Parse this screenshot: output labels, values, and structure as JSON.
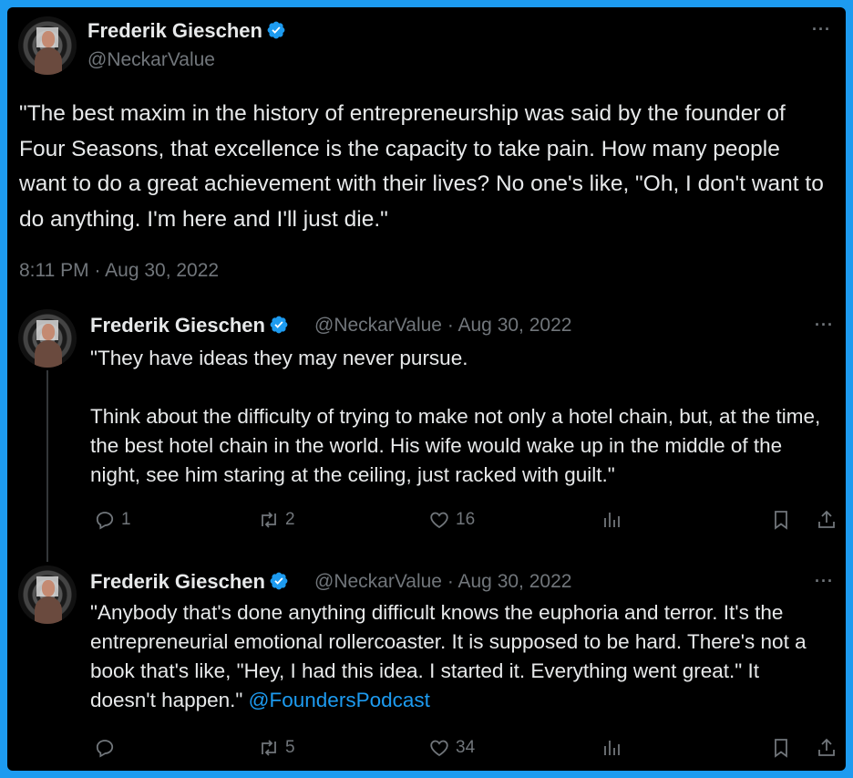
{
  "main_tweet": {
    "author_name": "Frederik Gieschen",
    "handle": "@NeckarValue",
    "text": "\"The best maxim in the history of entrepreneurship was said by the founder of Four Seasons, that excellence is the capacity to take pain. How many people want to do a great achievement with their lives? No one's like, \"Oh, I don't want to do anything. I'm here and I'll just die.\"",
    "timestamp": "8:11 PM · Aug 30, 2022"
  },
  "replies": [
    {
      "author_name": "Frederik Gieschen",
      "meta": "@NeckarValue · Aug 30, 2022",
      "text": "\"They have ideas they may never pursue.\n\nThink about the difficulty of trying to make not only a hotel chain, but, at the time, the best hotel chain in the world. His wife would wake up in the middle of the night, see him staring at the ceiling, just racked with guilt.\"",
      "mention": "",
      "reply_count": "1",
      "retweet_count": "2",
      "like_count": "16"
    },
    {
      "author_name": "Frederik Gieschen",
      "meta": "@NeckarValue · Aug 30, 2022",
      "text": "\"Anybody that's done anything difficult knows the euphoria and terror. It's the entrepreneurial emotional rollercoaster. It is supposed to be hard. There's not a book that's like, \"Hey, I had this idea. I started it. Everything went great.\" It doesn't happen.\" ",
      "mention": "@FoundersPodcast",
      "reply_count": "",
      "retweet_count": "5",
      "like_count": "34"
    }
  ],
  "more_label": "···",
  "colors": {
    "frame_border": "#1d9bf0",
    "verified": "#1d9bf0",
    "secondary_text": "#71767b",
    "link": "#1d9bf0"
  },
  "icons": [
    "verified-badge-icon",
    "more-icon",
    "reply-icon",
    "retweet-icon",
    "like-icon",
    "analytics-icon",
    "bookmark-icon",
    "share-icon"
  ]
}
